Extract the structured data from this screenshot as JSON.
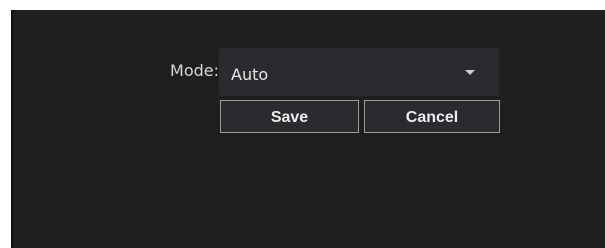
{
  "form": {
    "mode_label": "Mode:",
    "mode_value": "Auto",
    "mode_dropdown_icon": "chevron-down-icon"
  },
  "actions": {
    "save_label": "Save",
    "cancel_label": "Cancel"
  },
  "colors": {
    "background": "#1e1f21",
    "control_background": "#2a2b2e",
    "text": "#e6e6e6",
    "button_border": "#9a9a9a"
  }
}
